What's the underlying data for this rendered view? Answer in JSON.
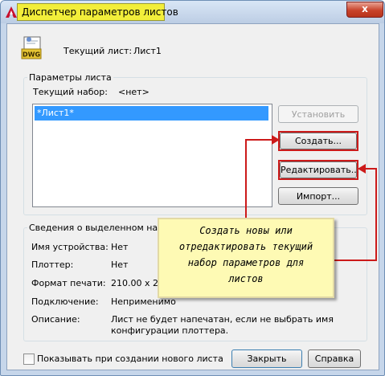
{
  "window": {
    "title": "Диспетчер параметров листов",
    "close_symbol": "x",
    "app_icon": "autocad-a-icon"
  },
  "current_sheet": {
    "icon": "dwg-file-icon",
    "icon_text": "DWG",
    "label": "Текущий лист:",
    "value": "Лист1"
  },
  "page_setups": {
    "group_title": "Параметры листа",
    "current_set_label": "Текущий набор:",
    "current_set_value": "<нет>",
    "items": [
      "*Лист1*"
    ],
    "selected_index": 0,
    "buttons": {
      "set_current": "Установить",
      "new": "Создать...",
      "modify": "Редактировать...",
      "import": "Импорт..."
    }
  },
  "details": {
    "group_title": "Сведения о выделенном наборе",
    "rows": [
      {
        "label": "Имя устройства:",
        "value": "Нет"
      },
      {
        "label": "Плоттер:",
        "value": "Нет"
      },
      {
        "label": "Формат печати:",
        "value": "210.00 x 29"
      },
      {
        "label": "Подключение:",
        "value": "Неприменимо"
      },
      {
        "label": "Описание:",
        "value": "Лист не будет напечатан, если не выбрать имя",
        "value2": "конфигурации плоттера."
      }
    ]
  },
  "footer": {
    "checkbox_label": "Показывать при создании нового листа",
    "checkbox_checked": false,
    "close_button": "Закрыть",
    "help_button": "Справка"
  },
  "annotation": {
    "lines": [
      "Создать новы или",
      "отредактировать текущий",
      "набор параметров для",
      "листов"
    ],
    "highlight_color": "#f2ee3a",
    "arrow_color": "#cc1a1a",
    "note_color": "#fefab4"
  }
}
